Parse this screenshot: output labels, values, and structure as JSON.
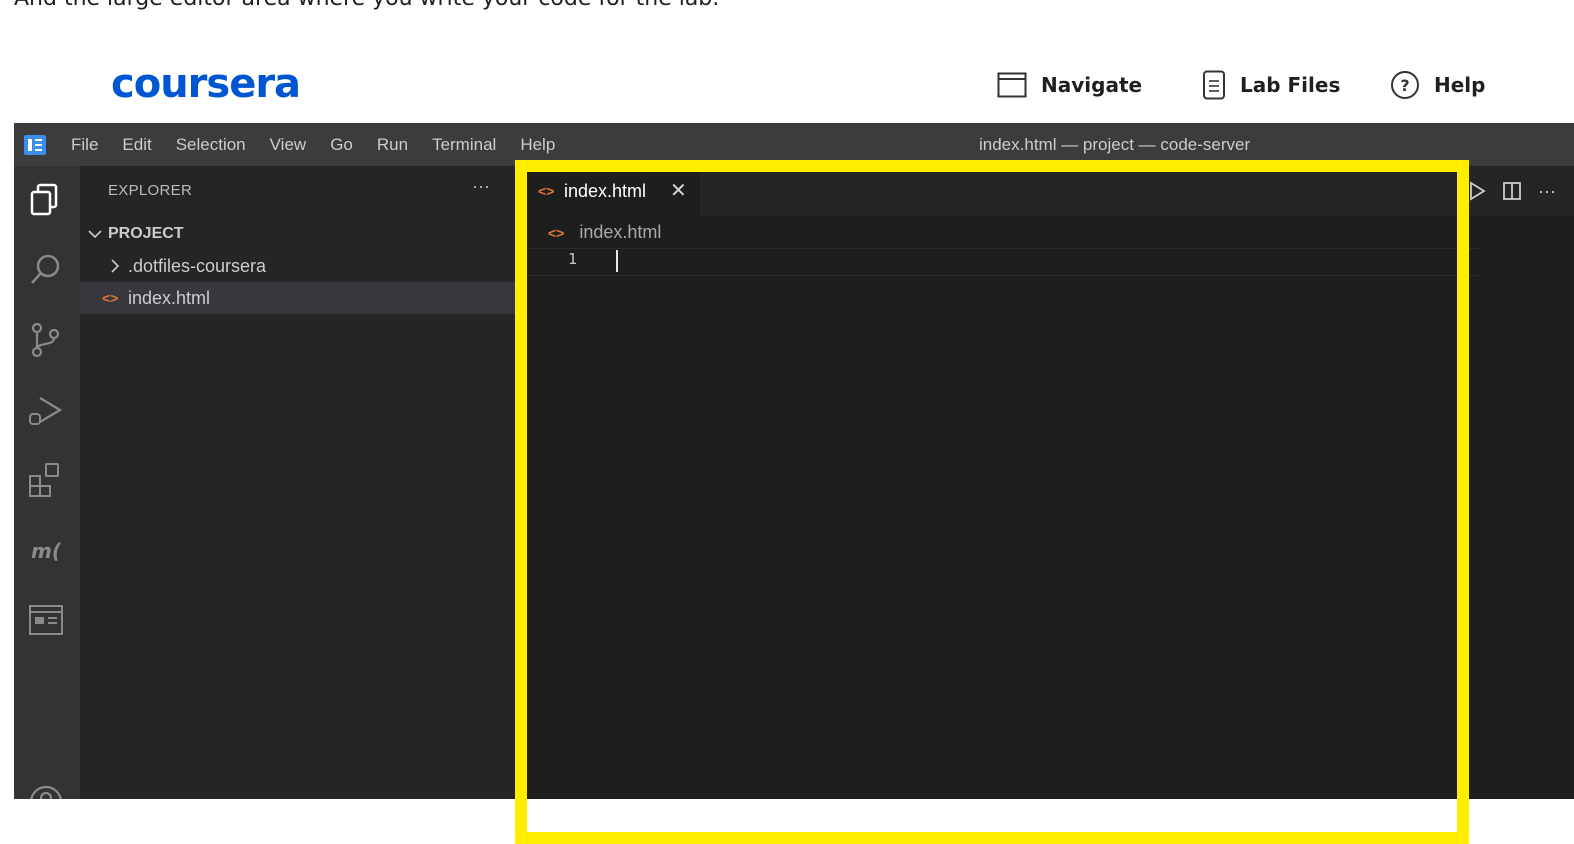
{
  "caption": "And the large editor area where you write your code for the lab.",
  "header": {
    "logo": "coursera",
    "nav": [
      {
        "label": "Navigate",
        "icon": "window-icon"
      },
      {
        "label": "Lab Files",
        "icon": "file-icon"
      },
      {
        "label": "Help",
        "icon": "help-circle-icon"
      }
    ]
  },
  "ide": {
    "menu": [
      "File",
      "Edit",
      "Selection",
      "View",
      "Go",
      "Run",
      "Terminal",
      "Help"
    ],
    "window_title": "index.html — project — code-server",
    "explorer": {
      "title": "EXPLORER",
      "more": "···",
      "project": "PROJECT",
      "items": [
        ".dotfiles-coursera",
        "index.html"
      ]
    },
    "editor": {
      "tab_label": "index.html",
      "close": "✕",
      "breadcrumb": "index.html",
      "line_number": "1"
    },
    "colors": {
      "highlight": "#ffee00",
      "html_icon": "#e37933",
      "brand": "#0056d2"
    }
  }
}
